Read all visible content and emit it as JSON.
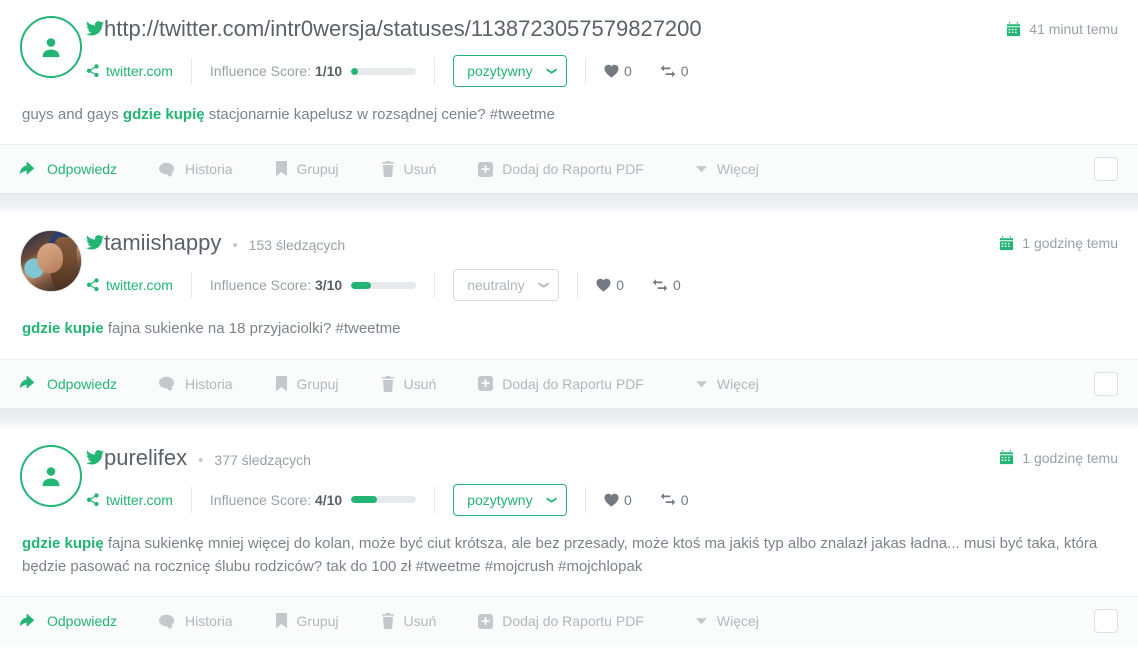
{
  "labels": {
    "influence_prefix": "Influence Score: ",
    "source_name": "twitter.com",
    "followers_suffix": " śledzących"
  },
  "actions": {
    "reply": "Odpowiedz",
    "history": "Historia",
    "group": "Grupuj",
    "delete": "Usuń",
    "add_pdf": "Dodaj do Raportu PDF",
    "more": "Więcej"
  },
  "colors": {
    "accent": "#22b573",
    "text_muted": "#9aa0a6",
    "text_dark": "#5b6168",
    "action_bar_bg": "#fafbfb"
  },
  "posts": [
    {
      "avatar_type": "placeholder",
      "title": "http://twitter.com/intr0wersja/statuses/1138723057579827200",
      "is_username": false,
      "followers": "",
      "timestamp": "41 minut temu",
      "source": "twitter.com",
      "influence_score": "1/10",
      "influence_percent": 10,
      "sentiment": "pozytywny",
      "sentiment_type": "positive",
      "likes": "0",
      "retweets": "0",
      "text_parts": [
        {
          "t": "guys and gays ",
          "kw": false
        },
        {
          "t": "gdzie kupię",
          "kw": true
        },
        {
          "t": " stacjonarnie kapelusz w rozsądnej cenie? #tweetme",
          "kw": false
        }
      ]
    },
    {
      "avatar_type": "photo",
      "title": "tamiishappy",
      "is_username": true,
      "followers": "153 śledzących",
      "timestamp": "1 godzinę temu",
      "source": "twitter.com",
      "influence_score": "3/10",
      "influence_percent": 30,
      "sentiment": "neutralny",
      "sentiment_type": "neutral",
      "likes": "0",
      "retweets": "0",
      "text_parts": [
        {
          "t": "gdzie kupie",
          "kw": true
        },
        {
          "t": " fajna sukienke na 18 przyjaciolki? #tweetme",
          "kw": false
        }
      ]
    },
    {
      "avatar_type": "placeholder",
      "title": "purelifex",
      "is_username": true,
      "followers": "377 śledzących",
      "timestamp": "1 godzinę temu",
      "source": "twitter.com",
      "influence_score": "4/10",
      "influence_percent": 40,
      "sentiment": "pozytywny",
      "sentiment_type": "positive",
      "likes": "0",
      "retweets": "0",
      "text_parts": [
        {
          "t": "gdzie kupię",
          "kw": true
        },
        {
          "t": " fajna sukienkę mniej więcej do kolan, może być ciut krótsza, ale bez przesady, może ktoś ma jakiś typ albo znalazł jakas ładna... musi być taka, która będzie pasować na rocznicę ślubu rodziców? tak do 100 zł #tweetme #mojcrush #mojchlopak",
          "kw": false
        }
      ]
    }
  ]
}
